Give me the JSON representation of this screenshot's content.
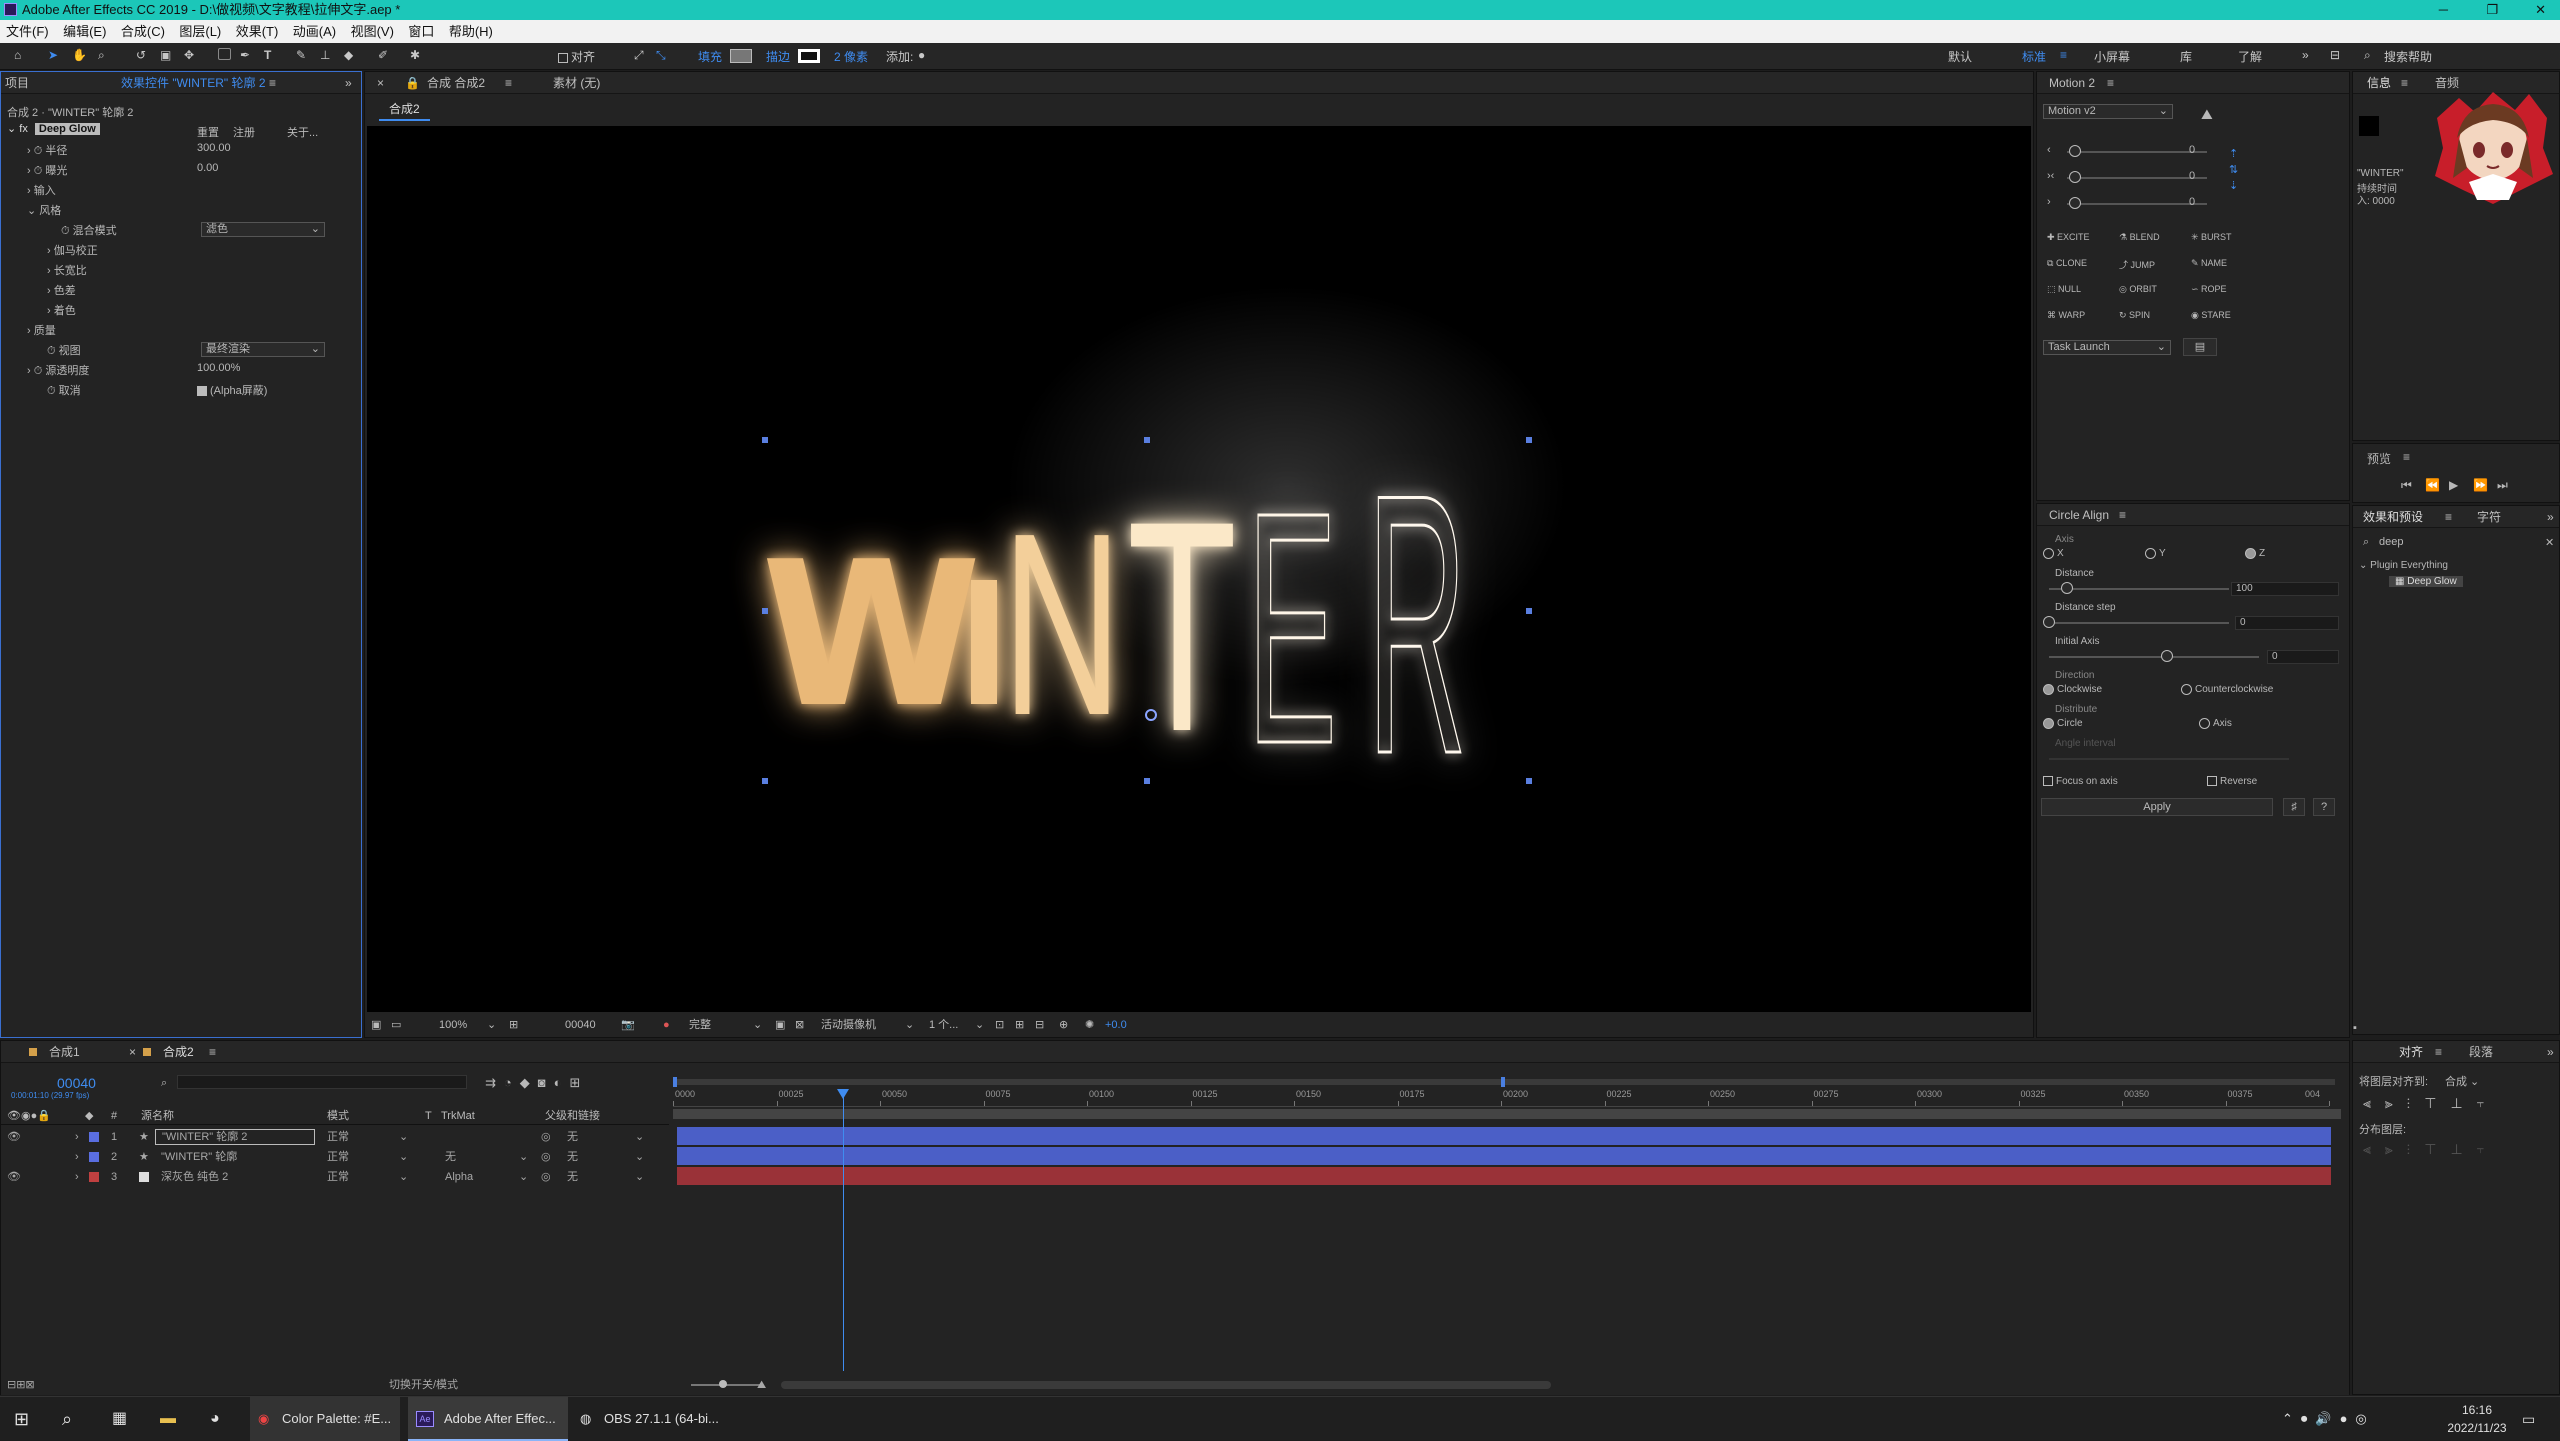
{
  "window": {
    "title": "Adobe After Effects CC 2019 - D:\\做视频\\文字教程\\拉伸文字.aep *"
  },
  "menu": [
    "文件(F)",
    "编辑(E)",
    "合成(C)",
    "图层(L)",
    "效果(T)",
    "动画(A)",
    "视图(V)",
    "窗口",
    "帮助(H)"
  ],
  "toolbar": {
    "align_label": "对齐",
    "fill_label": "填充",
    "stroke_label": "描边",
    "stroke_size": "2 像素",
    "add_label": "添加:",
    "workspaces": [
      "默认",
      "标准",
      "小屏幕",
      "库",
      "了解"
    ],
    "search_placeholder": "搜索帮助"
  },
  "effects_panel": {
    "tabs": [
      "项目",
      "效果控件 \"WINTER\" 轮廓 2"
    ],
    "breadcrumb": "合成 2 · \"WINTER\" 轮廓 2",
    "effect_name": "Deep Glow",
    "effect_links": [
      "重置",
      "注册",
      "关于..."
    ],
    "params": [
      {
        "label": "半径",
        "value": "300.00"
      },
      {
        "label": "曝光",
        "value": "0.00"
      },
      {
        "label": "输入",
        "value": ""
      },
      {
        "label": "风格",
        "value": ""
      },
      {
        "label": "混合模式",
        "value": "滤色"
      },
      {
        "label": "伽马校正",
        "value": ""
      },
      {
        "label": "长宽比",
        "value": ""
      },
      {
        "label": "色差",
        "value": ""
      },
      {
        "label": "着色",
        "value": ""
      },
      {
        "label": "质量",
        "value": ""
      },
      {
        "label": "视图",
        "value": "最终渲染"
      },
      {
        "label": "源透明度",
        "value": "100.00%"
      },
      {
        "label": "取消",
        "value": "(Alpha屏蔽)"
      }
    ]
  },
  "comp_panel": {
    "tab": "合成 合成2",
    "source": "素材 (无)",
    "subtab": "合成2",
    "text_letters": [
      "W",
      "I",
      "N",
      "T",
      "E",
      "R"
    ],
    "footer": {
      "zoom": "100%",
      "time": "00040",
      "quality": "完整",
      "camera": "活动摄像机",
      "views": "1 个...",
      "exposure": "+0.0"
    }
  },
  "motion_panel": {
    "title": "Motion 2",
    "dropdown": "Motion v2",
    "slider_values": [
      "0",
      "0",
      "0"
    ],
    "buttons": [
      "EXCITE",
      "BLEND",
      "BURST",
      "CLONE",
      "JUMP",
      "NAME",
      "NULL",
      "ORBIT",
      "ROPE",
      "WARP",
      "SPIN",
      "STARE"
    ],
    "task": "Task Launch"
  },
  "circle_panel": {
    "title": "Circle Align",
    "axis_label": "Axis",
    "axis_opts": [
      "X",
      "Y",
      "Z"
    ],
    "distance_label": "Distance",
    "distance": "100",
    "step_label": "Distance step",
    "step": "0",
    "initial_label": "Initial Axis",
    "initial": "0",
    "direction_label": "Direction",
    "dir_opts": [
      "Clockwise",
      "Counterclockwise"
    ],
    "distribute_label": "Distribute",
    "dist_opts": [
      "Circle",
      "Axis"
    ],
    "angle_label": "Angle interval",
    "focus": "Focus on axis",
    "reverse": "Reverse",
    "apply": "Apply"
  },
  "right_panels": {
    "info_tabs": [
      "信息",
      "音频"
    ],
    "info_lines": [
      "\"WINTER\"",
      "持续时间",
      "入: 0000"
    ],
    "preview_title": "预览",
    "effects_tabs": [
      "效果和预设",
      "字符"
    ],
    "search_value": "deep",
    "tree_folder": "Plugin Everything",
    "tree_item": "Deep Glow",
    "align_tabs": [
      "对齐",
      "段落"
    ],
    "align_to_label": "将图层对齐到:",
    "align_to": "合成",
    "distribute_label": "分布图层:"
  },
  "timeline": {
    "tabs": [
      "合成1",
      "合成2"
    ],
    "timecode": "00040",
    "timecode_sub": "0:00:01:10 (29.97 fps)",
    "headers": [
      "源名称",
      "模式",
      "T",
      "TrkMat",
      "父级和链接"
    ],
    "layers": [
      {
        "num": "1",
        "name": "\"WINTER\" 轮廓 2",
        "mode": "正常",
        "trkmat": "",
        "parent": "无",
        "color": "#5a6ee0"
      },
      {
        "num": "2",
        "name": "\"WINTER\" 轮廓",
        "mode": "正常",
        "trkmat": "无",
        "parent": "无",
        "color": "#5a6ee0"
      },
      {
        "num": "3",
        "name": "深灰色 纯色 2",
        "mode": "正常",
        "trkmat": "Alpha",
        "parent": "无",
        "color": "#c04040"
      }
    ],
    "ruler": [
      "0000",
      "00025",
      "00050",
      "00075",
      "00100",
      "00125",
      "00150",
      "00175",
      "00200",
      "00225",
      "00250",
      "00275",
      "00300",
      "00325",
      "00350",
      "00375",
      "004"
    ],
    "footer_label": "切换开关/模式"
  },
  "taskbar": {
    "items": [
      "Color Palette: #E...",
      "Adobe After Effec...",
      "OBS 27.1.1 (64-bi..."
    ],
    "time": "16:16",
    "date": "2022/11/23"
  }
}
